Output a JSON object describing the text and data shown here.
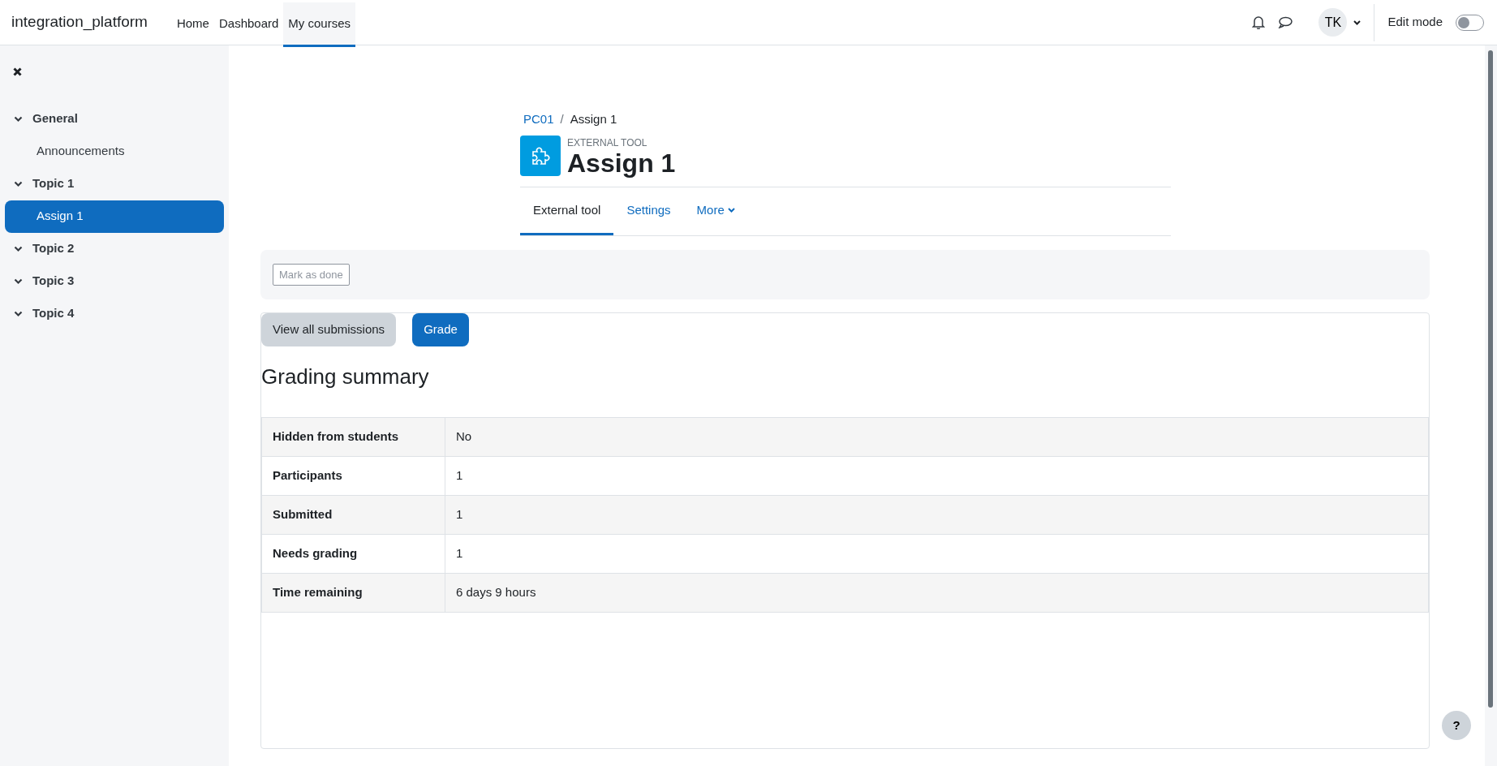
{
  "navbar": {
    "brand": "integration_platform",
    "links": [
      {
        "label": "Home",
        "selected": false
      },
      {
        "label": "Dashboard",
        "selected": false
      },
      {
        "label": "My courses",
        "selected": true
      }
    ],
    "avatar": "TK",
    "edit_mode": {
      "label": "Edit mode",
      "on": false
    }
  },
  "sidebar": {
    "sections": [
      {
        "title": "General",
        "expanded": true,
        "children": [
          {
            "label": "Announcements",
            "selected": false
          }
        ]
      },
      {
        "title": "Topic 1",
        "expanded": true,
        "children": [
          {
            "label": "Assign 1",
            "selected": true
          }
        ]
      },
      {
        "title": "Topic 2",
        "expanded": true
      },
      {
        "title": "Topic 3",
        "expanded": true
      },
      {
        "title": "Topic 4",
        "expanded": true
      }
    ]
  },
  "breadcrumb": {
    "separator": "/",
    "items": [
      "PC01",
      "Assign 1"
    ]
  },
  "activity": {
    "type": "EXTERNAL TOOL",
    "title": "Assign 1"
  },
  "tabs": [
    {
      "label": "External tool",
      "selected": true
    },
    {
      "label": "Settings",
      "selected": false
    },
    {
      "label": "More",
      "selected": false
    }
  ],
  "completion_button": "Mark as done",
  "actions": [
    {
      "label": "View all submissions",
      "kind": "secondary"
    },
    {
      "label": "Grade",
      "kind": "primary"
    }
  ],
  "grading_summary": {
    "title": "Grading summary",
    "rows": [
      {
        "label": "Hidden from students",
        "value": "No"
      },
      {
        "label": "Participants",
        "value": "1"
      },
      {
        "label": "Submitted",
        "value": "1"
      },
      {
        "label": "Needs grading",
        "value": "1"
      },
      {
        "label": "Time remaining",
        "value": "6 days 9 hours"
      }
    ]
  },
  "help_button": "?"
}
